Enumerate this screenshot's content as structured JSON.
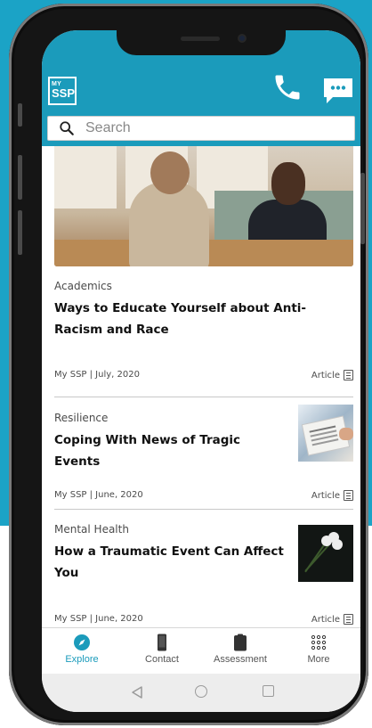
{
  "app": {
    "logo_line1": "MY",
    "logo_line2": "SSP",
    "accent_color": "#1b9bbb",
    "backdrop_color": "#1ba3c6"
  },
  "header": {
    "call_icon": "phone-icon",
    "chat_icon": "chat-bubble-icon"
  },
  "search": {
    "placeholder": "Search",
    "value": ""
  },
  "feed": {
    "articles": [
      {
        "category": "Academics",
        "title": "Ways to Educate Yourself about Anti-Racism and Race",
        "meta": "My SSP | July, 2020",
        "type": "Article",
        "image": "two-people-talking-photo"
      },
      {
        "category": "Resilience",
        "title": "Coping With News of Tragic Events",
        "meta": "My SSP | June, 2020",
        "type": "Article",
        "image": "newspaper-photo"
      },
      {
        "category": "Mental Health",
        "title": "How a Traumatic Event Can Affect You",
        "meta": "My SSP | June, 2020",
        "type": "Article",
        "image": "white-flowers-photo"
      }
    ]
  },
  "tabbar": {
    "tabs": [
      {
        "label": "Explore",
        "icon": "compass-icon",
        "active": true
      },
      {
        "label": "Contact",
        "icon": "phone-device-icon",
        "active": false
      },
      {
        "label": "Assessment",
        "icon": "clipboard-icon",
        "active": false
      },
      {
        "label": "More",
        "icon": "grid-dots-icon",
        "active": false
      }
    ]
  }
}
